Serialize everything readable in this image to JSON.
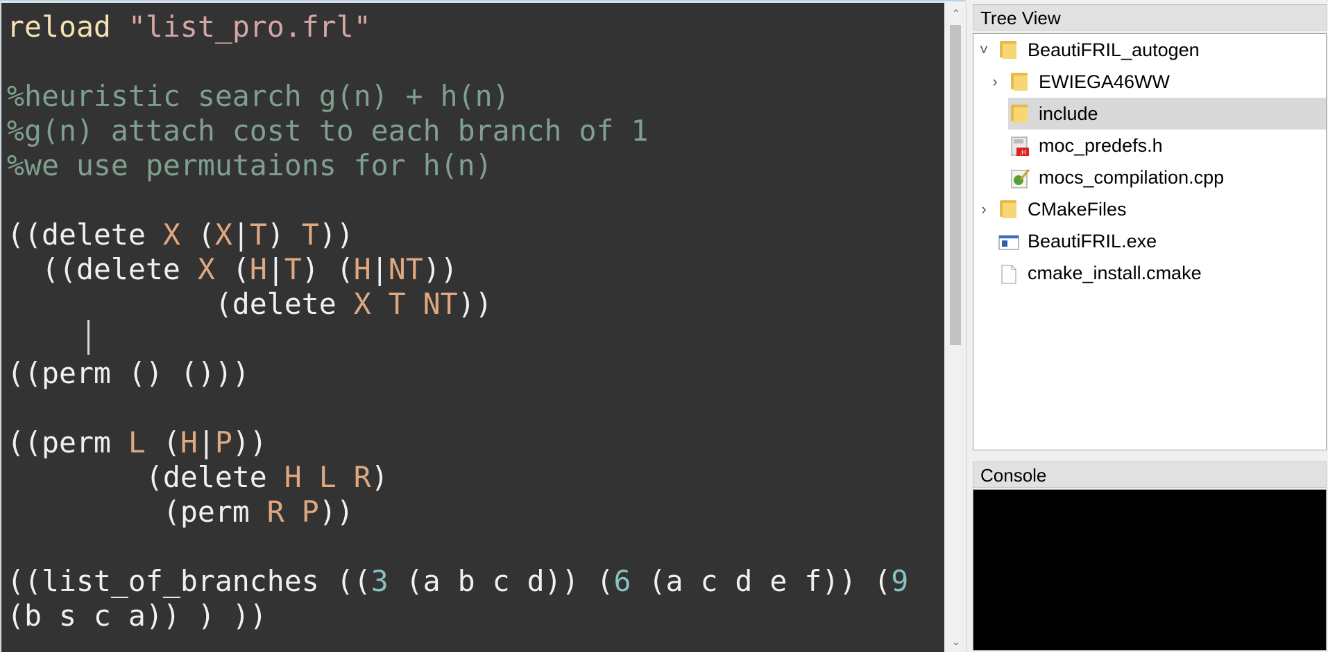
{
  "editor": {
    "lines": [
      [
        {
          "t": "reload ",
          "c": "kw"
        },
        {
          "t": "\"list_pro.frl\"",
          "c": "str"
        }
      ],
      [],
      [
        {
          "t": "%heuristic search g(n) + h(n)",
          "c": "cm"
        }
      ],
      [
        {
          "t": "%g(n) attach cost to each branch of 1",
          "c": "cm"
        }
      ],
      [
        {
          "t": "%we use permutaions for h(n)",
          "c": "cm"
        }
      ],
      [],
      [
        {
          "t": "((delete "
        },
        {
          "t": "X",
          "c": "var"
        },
        {
          "t": " ("
        },
        {
          "t": "X",
          "c": "var"
        },
        {
          "t": "|"
        },
        {
          "t": "T",
          "c": "var"
        },
        {
          "t": ") "
        },
        {
          "t": "T",
          "c": "var"
        },
        {
          "t": "))"
        }
      ],
      [
        {
          "t": "  ((delete "
        },
        {
          "t": "X",
          "c": "var"
        },
        {
          "t": " ("
        },
        {
          "t": "H",
          "c": "var"
        },
        {
          "t": "|"
        },
        {
          "t": "T",
          "c": "var"
        },
        {
          "t": ") ("
        },
        {
          "t": "H",
          "c": "var"
        },
        {
          "t": "|"
        },
        {
          "t": "NT",
          "c": "var"
        },
        {
          "t": "))"
        }
      ],
      [
        {
          "t": "            (delete "
        },
        {
          "t": "X T NT",
          "c": "var"
        },
        {
          "t": "))"
        }
      ],
      [],
      [
        {
          "t": "((perm () ()))"
        }
      ],
      [],
      [
        {
          "t": "((perm "
        },
        {
          "t": "L",
          "c": "var"
        },
        {
          "t": " ("
        },
        {
          "t": "H",
          "c": "var"
        },
        {
          "t": "|"
        },
        {
          "t": "P",
          "c": "var"
        },
        {
          "t": "))"
        }
      ],
      [
        {
          "t": "        (delete "
        },
        {
          "t": "H L R",
          "c": "var"
        },
        {
          "t": ")"
        }
      ],
      [
        {
          "t": "         (perm "
        },
        {
          "t": "R P",
          "c": "var"
        },
        {
          "t": "))"
        }
      ],
      [],
      [
        {
          "t": "((list_of_branches (("
        },
        {
          "t": "3",
          "c": "num"
        },
        {
          "t": " (a b c d)) ("
        },
        {
          "t": "6",
          "c": "num"
        },
        {
          "t": " (a c d e f)) ("
        },
        {
          "t": "9",
          "c": "num"
        }
      ],
      [
        {
          "t": "(b s c a)) ) ))"
        }
      ]
    ]
  },
  "tree_view": {
    "title": "Tree View",
    "items": [
      {
        "label": "BeautiFRIL_autogen",
        "icon": "folder-icon",
        "chevron": "expanded",
        "depth": 0,
        "selected": false
      },
      {
        "label": "EWIEGA46WW",
        "icon": "folder-icon",
        "chevron": "collapsed",
        "depth": 1,
        "selected": false
      },
      {
        "label": "include",
        "icon": "folder-icon",
        "chevron": "none",
        "depth": 1,
        "selected": true
      },
      {
        "label": "moc_predefs.h",
        "icon": "header-file-icon",
        "chevron": "none",
        "depth": 1,
        "selected": false
      },
      {
        "label": "mocs_compilation.cpp",
        "icon": "cpp-file-icon",
        "chevron": "none",
        "depth": 1,
        "selected": false
      },
      {
        "label": "CMakeFiles",
        "icon": "folder-icon",
        "chevron": "collapsed",
        "depth": 0,
        "selected": false
      },
      {
        "label": "BeautiFRIL.exe",
        "icon": "exe-file-icon",
        "chevron": "none",
        "depth": 0,
        "selected": false
      },
      {
        "label": "cmake_install.cmake",
        "icon": "blank-file-icon",
        "chevron": "none",
        "depth": 0,
        "selected": false
      }
    ]
  },
  "console": {
    "title": "Console"
  }
}
